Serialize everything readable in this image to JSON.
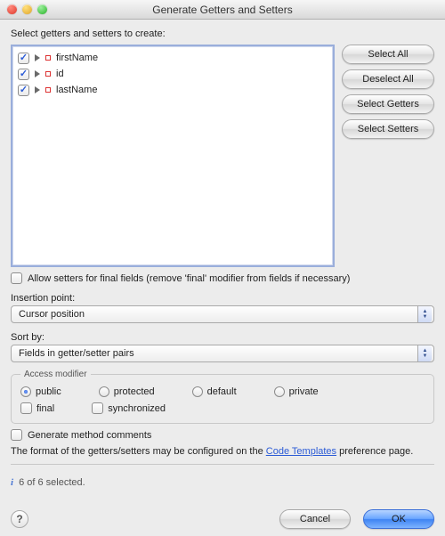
{
  "title": "Generate Getters and Setters",
  "instruction": "Select getters and setters to create:",
  "fields": [
    {
      "checked": true,
      "name": "firstName"
    },
    {
      "checked": true,
      "name": "id"
    },
    {
      "checked": true,
      "name": "lastName"
    }
  ],
  "buttons": {
    "selectAll": "Select All",
    "deselectAll": "Deselect All",
    "selectGetters": "Select Getters",
    "selectSetters": "Select Setters"
  },
  "allowFinal": {
    "checked": false,
    "label": "Allow setters for final fields (remove 'final' modifier from fields if necessary)"
  },
  "insertionPoint": {
    "label": "Insertion point:",
    "value": "Cursor position"
  },
  "sortBy": {
    "label": "Sort by:",
    "value": "Fields in getter/setter pairs"
  },
  "accessModifier": {
    "legend": "Access modifier",
    "options": {
      "public": "public",
      "protected": "protected",
      "default": "default",
      "private": "private"
    },
    "selected": "public",
    "final": {
      "checked": false,
      "label": "final"
    },
    "synchronized": {
      "checked": false,
      "label": "synchronized"
    }
  },
  "generateComments": {
    "checked": false,
    "label": "Generate method comments"
  },
  "footnote": {
    "pre": "The format of the getters/setters may be configured on the ",
    "link": "Code Templates",
    "post": " preference page."
  },
  "status": "6 of 6 selected.",
  "bottom": {
    "cancel": "Cancel",
    "ok": "OK"
  }
}
